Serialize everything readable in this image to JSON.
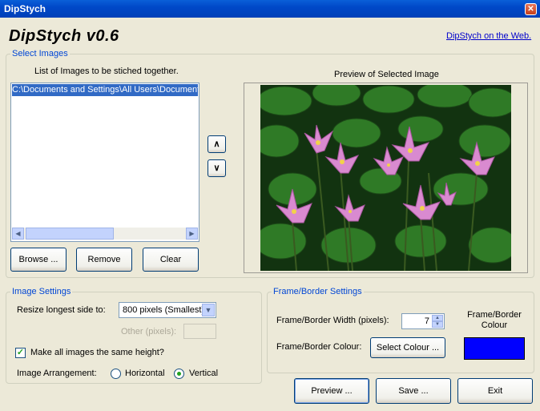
{
  "window": {
    "title": "DipStych",
    "close_glyph": "✕"
  },
  "header": {
    "app_title": "DipStych v0.6",
    "web_link": "DipStych on the Web."
  },
  "select_images": {
    "group_label": "Select Images",
    "list_caption": "List of Images to be stiched together.",
    "items": [
      "C:\\Documents and Settings\\All Users\\Documents\\My Pictures\\Sample Pictures\\Water lilies.jpg"
    ],
    "scroll_left": "◀",
    "scroll_right": "▶",
    "move_up": "∧",
    "move_down": "∨",
    "browse_label": "Browse ...",
    "remove_label": "Remove",
    "clear_label": "Clear",
    "preview_caption": "Preview of Selected Image"
  },
  "image_settings": {
    "group_label": "Image Settings",
    "resize_label": "Resize longest side to:",
    "resize_value": "800 pixels (Smallest)",
    "other_label": "Other (pixels):",
    "other_value": "",
    "same_height_label": "Make all images the same height?",
    "same_height_checked": true,
    "check_glyph": "✓",
    "arrangement_label": "Image Arrangement:",
    "horizontal_label": "Horizontal",
    "vertical_label": "Vertical",
    "selected_arrangement": "Vertical"
  },
  "frame_settings": {
    "group_label": "Frame/Border Settings",
    "width_label": "Frame/Border Width (pixels):",
    "width_value": "7",
    "colour_label": "Frame/Border Colour:",
    "select_colour_label": "Select Colour ...",
    "colour_caption": "Frame/Border Colour",
    "colour_value": "#0000ff"
  },
  "actions": {
    "preview_label": "Preview ...",
    "save_label": "Save ...",
    "exit_label": "Exit"
  },
  "icons": {
    "combo_arrow": "chevron-down-icon",
    "spin_up": "spin-up-icon",
    "spin_down": "spin-down-icon"
  }
}
